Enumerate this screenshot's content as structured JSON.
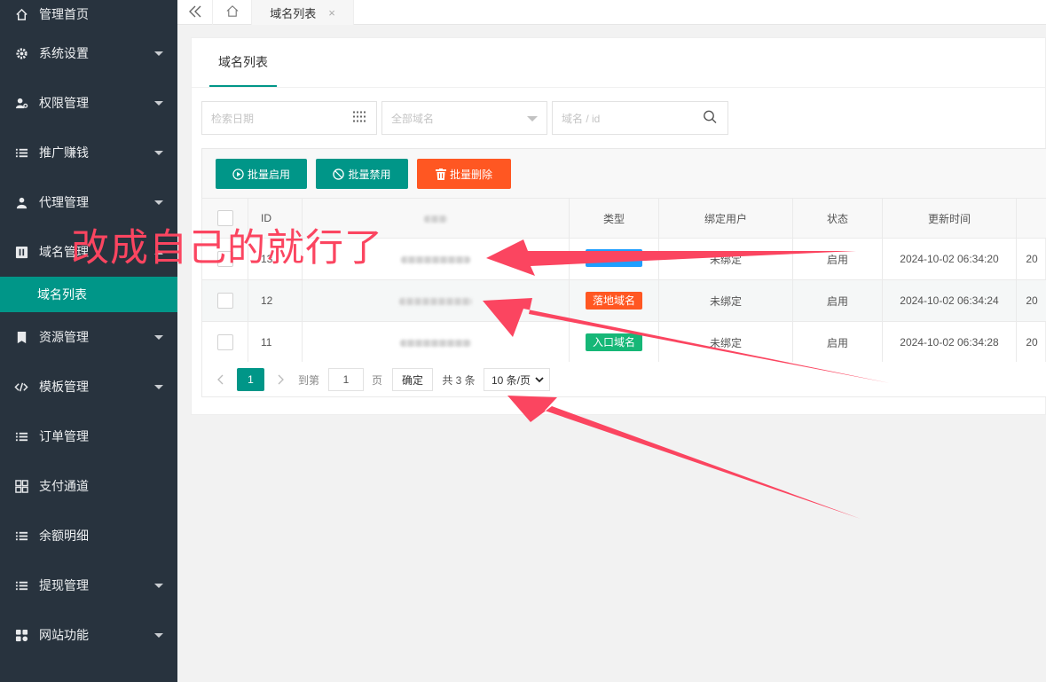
{
  "sidebar": {
    "items": [
      {
        "label": "管理首页",
        "icon": "home-icon",
        "caret": false
      },
      {
        "label": "系统设置",
        "icon": "gear-icon",
        "caret": true
      },
      {
        "label": "权限管理",
        "icon": "user-key-icon",
        "caret": true
      },
      {
        "label": "推广赚钱",
        "icon": "list-icon",
        "caret": true
      },
      {
        "label": "代理管理",
        "icon": "agent-icon",
        "caret": true
      },
      {
        "label": "域名管理",
        "icon": "domain-icon",
        "caret": true,
        "expanded": true
      },
      {
        "label": "资源管理",
        "icon": "resource-icon",
        "caret": true
      },
      {
        "label": "模板管理",
        "icon": "code-icon",
        "caret": true
      },
      {
        "label": "订单管理",
        "icon": "list-icon",
        "caret": false
      },
      {
        "label": "支付通道",
        "icon": "grid-icon",
        "caret": false
      },
      {
        "label": "余额明细",
        "icon": "list-icon",
        "caret": false
      },
      {
        "label": "提现管理",
        "icon": "list-icon",
        "caret": true
      },
      {
        "label": "网站功能",
        "icon": "apps-icon",
        "caret": true
      }
    ],
    "sub_active": "域名列表"
  },
  "topbar": {
    "active_tab": "域名列表",
    "close_glyph": "×"
  },
  "card": {
    "tab_title": "域名列表"
  },
  "filters": {
    "date_placeholder": "检索日期",
    "domain_select": "全部域名",
    "search_placeholder": "域名 / id"
  },
  "toolbar": {
    "enable_label": "批量启用",
    "disable_label": "批量禁用",
    "delete_label": "批量删除"
  },
  "table": {
    "headers": {
      "id": "ID",
      "type": "类型",
      "user": "绑定用户",
      "status": "状态",
      "updated": "更新时间"
    },
    "rows": [
      {
        "id": "13",
        "type": "",
        "type_color": "#1e9fff",
        "user": "未绑定",
        "status": "启用",
        "updated": "2024-10-02 06:34:20",
        "trail": "20"
      },
      {
        "id": "12",
        "type": "落地域名",
        "type_color": "#ff5722",
        "user": "未绑定",
        "status": "启用",
        "updated": "2024-10-02 06:34:24",
        "trail": "20"
      },
      {
        "id": "11",
        "type": "入口域名",
        "type_color": "#16b777",
        "user": "未绑定",
        "status": "启用",
        "updated": "2024-10-02 06:34:28",
        "trail": "20"
      }
    ]
  },
  "pager": {
    "current": "1",
    "goto_label": "到第",
    "goto_value": "1",
    "page_label": "页",
    "confirm_label": "确定",
    "total_label": "共 3 条",
    "per_page": "10 条/页"
  },
  "annotation": {
    "text": "改成自己的就行了"
  },
  "colors": {
    "sidebar_bg": "#28333e",
    "accent": "#009688",
    "danger": "#ff5722",
    "arrow": "#fb4560"
  }
}
